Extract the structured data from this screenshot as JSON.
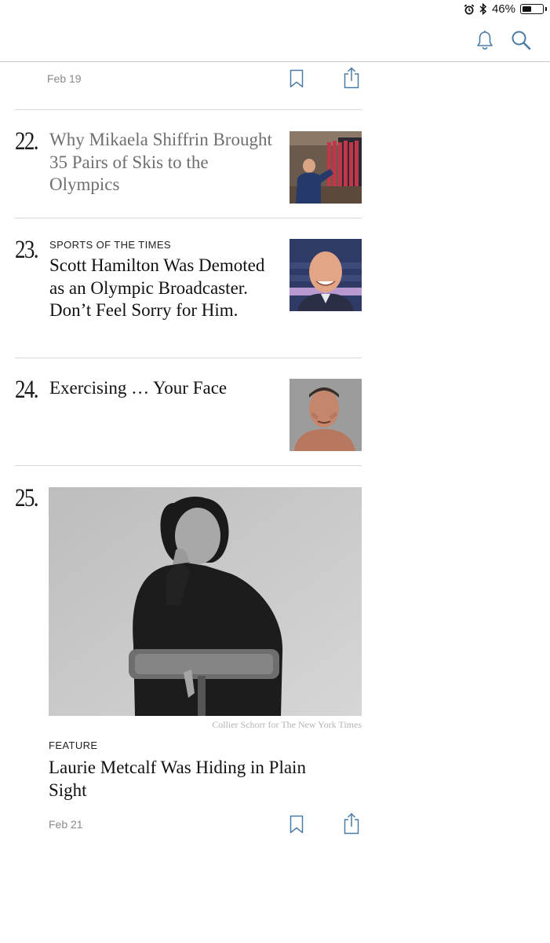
{
  "status_bar": {
    "battery_text": "46%",
    "battery_level": 0.46
  },
  "toolbar": {
    "icons": [
      "bell-icon",
      "search-icon"
    ]
  },
  "prev_item": {
    "date": "Feb 19"
  },
  "articles": [
    {
      "rank": "22.",
      "kicker": "",
      "headline": "Why Mikaela Shiffrin Brought 35 Pairs of Skis to the Olympics",
      "read": true
    },
    {
      "rank": "23.",
      "kicker": "SPORTS OF THE TIMES",
      "headline": "Scott Hamilton Was Demoted as an Olympic Broadcaster. Don’t Feel Sorry for Him.",
      "read": false
    },
    {
      "rank": "24.",
      "kicker": "",
      "headline": "Exercising … Your Face",
      "read": false
    }
  ],
  "feature": {
    "rank": "25.",
    "photo_credit": "Collier Schorr for The New York Times",
    "kicker": "FEATURE",
    "headline": "Laurie Metcalf Was Hiding in Plain Sight",
    "date": "Feb 21"
  },
  "colors": {
    "icon_blue": "#4a7ba6",
    "divider": "#d6d6d6",
    "read_headline": "#6f6f6f"
  }
}
